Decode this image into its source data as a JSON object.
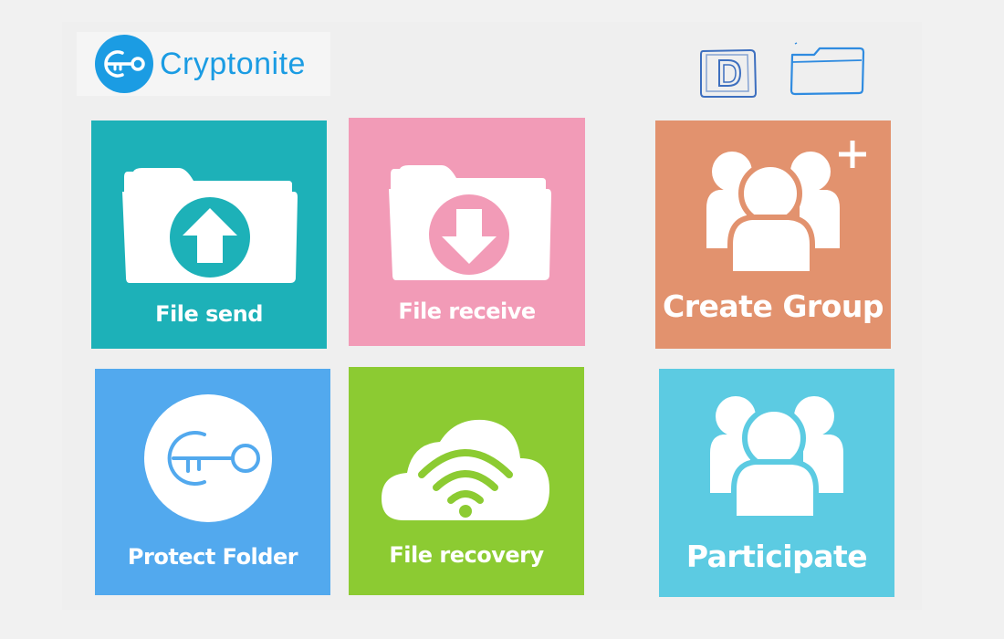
{
  "app": {
    "name": "Cryptonite",
    "brand_color": "#1b9ce3"
  },
  "header": {
    "icons": [
      "drive-icon",
      "folder-icon"
    ]
  },
  "tiles": [
    {
      "id": "file-send",
      "label": "File send",
      "icon": "folder-upload-icon",
      "color": "#1db1b8"
    },
    {
      "id": "file-receive",
      "label": "File receive",
      "icon": "folder-download-icon",
      "color": "#f29bb7"
    },
    {
      "id": "create-group",
      "label": "Create Group",
      "icon": "group-add-icon",
      "color": "#e2926e"
    },
    {
      "id": "protect-folder",
      "label": "Protect Folder",
      "icon": "key-icon",
      "color": "#52a9ee"
    },
    {
      "id": "file-recovery",
      "label": "File recovery",
      "icon": "cloud-wifi-icon",
      "color": "#8ccb32"
    },
    {
      "id": "participate",
      "label": "Participate",
      "icon": "group-icon",
      "color": "#5ccbe2"
    }
  ]
}
